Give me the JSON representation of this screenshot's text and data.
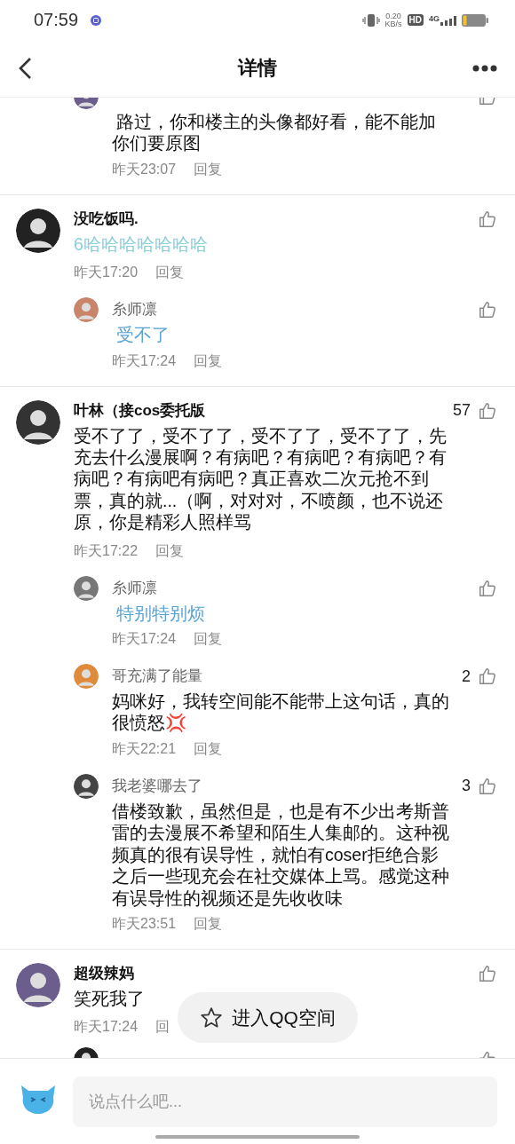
{
  "status_bar": {
    "time": "07:59",
    "net_speed": "0.20",
    "net_unit": "KB/s",
    "hd": "HD",
    "network": "4G"
  },
  "header": {
    "title": "详情"
  },
  "comments": [
    {
      "replies": [
        {
          "content": " 路过，你和楼主的头像都好看，能不能加你们要原图",
          "time": "昨天23:07",
          "reply": "回复"
        }
      ]
    },
    {
      "name": "没吃饭吗.",
      "content": "6哈哈哈哈哈哈哈",
      "color": "#86d0dc",
      "time": "昨天17:20",
      "reply": "回复",
      "replies": [
        {
          "name": "糸师凛",
          "content": " 受不了",
          "color": "#5aa3d2",
          "time": "昨天17:24",
          "reply": "回复"
        }
      ]
    },
    {
      "name": "叶林（接cos委托版",
      "content": "受不了了，受不了了，受不了了，受不了了，先充去什么漫展啊？有病吧？有病吧？有病吧？有病吧？有病吧有病吧？真正喜欢二次元抢不到票，真的就...（啊，对对对，不喷颜，也不说还原，你是精彩人照样骂",
      "likes": "57",
      "time": "昨天17:22",
      "reply": "回复",
      "replies": [
        {
          "name": "糸师凛",
          "content": " 特别特别烦",
          "color": "#5aa3d2",
          "time": "昨天17:24",
          "reply": "回复"
        },
        {
          "name": "哥充满了能量",
          "content": "妈咪好，我转空间能不能带上这句话，真的很愤怒💢",
          "likes": "2",
          "time": "昨天22:21",
          "reply": "回复"
        },
        {
          "name": "我老婆哪去了",
          "content": "借楼致歉，虽然但是，也是有不少出考斯普雷的去漫展不希望和陌生人集邮的。这种视频真的很有误导性，就怕有coser拒绝合影之后一些现充会在社交媒体上骂。感觉这种有误导性的视频还是先收收味",
          "likes": "3",
          "time": "昨天23:51",
          "reply": "回复"
        }
      ]
    },
    {
      "name": "超级辣妈",
      "content": "笑死我了",
      "time": "昨天17:24",
      "reply": "回",
      "replies": [
        {
          "kind": "cut"
        }
      ]
    }
  ],
  "floating_button": {
    "label": "进入QQ空间"
  },
  "composer": {
    "placeholder": "说点什么吧..."
  }
}
